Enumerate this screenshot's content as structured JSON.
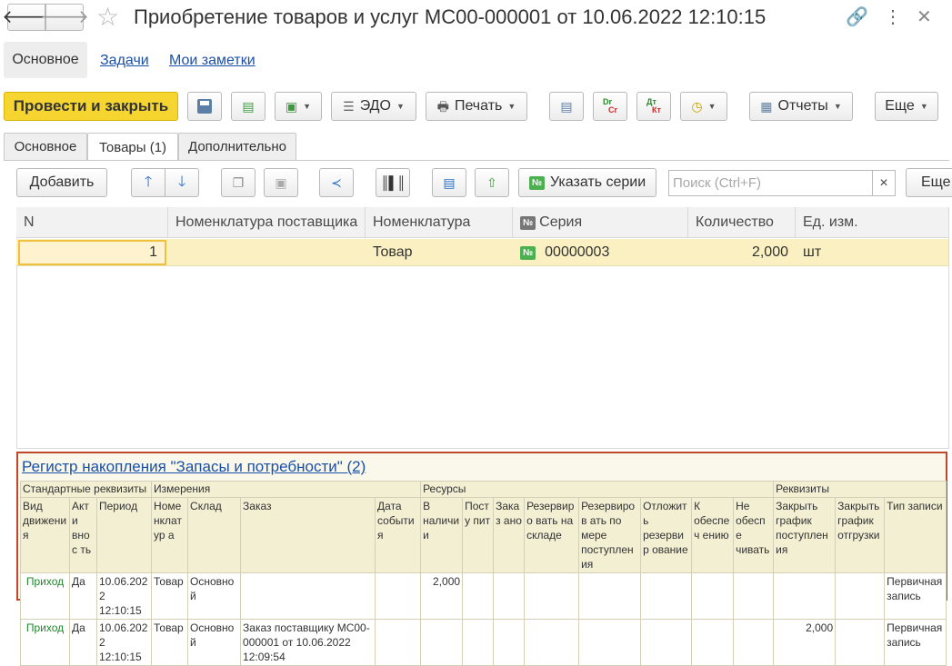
{
  "window": {
    "title": "Приобретение товаров и услуг МС00-000001 от 10.06.2022 12:10:15"
  },
  "nav_links": {
    "main": "Основное",
    "tasks": "Задачи",
    "notes": "Мои заметки"
  },
  "toolbar": {
    "post_close": "Провести и закрыть",
    "edo": "ЭДО",
    "print": "Печать",
    "dr_cr_top": "Dr",
    "dr_cr_bottom": "Cr",
    "dt_kt_top": "Дт",
    "dt_kt_bottom": "Кт",
    "reports": "Отчеты",
    "more": "Еще"
  },
  "tabs": [
    {
      "label": "Основное"
    },
    {
      "label": "Товары (1)"
    },
    {
      "label": "Дополнительно"
    }
  ],
  "grid_toolbar": {
    "add": "Добавить",
    "series_badge": "№",
    "set_series": "Указать серии",
    "search_placeholder": "Поиск (Ctrl+F)",
    "clear": "×",
    "more": "Еще"
  },
  "grid": {
    "columns": [
      "N",
      "Номенклатура поставщика",
      "Номенклатура",
      "Серия",
      "Количество",
      "Ед. изм."
    ],
    "series_col_badge": "№",
    "rows": [
      {
        "n": "1",
        "supplier_item": "",
        "item": "Товар",
        "series_badge": "№",
        "series": "00000003",
        "qty": "2,000",
        "unit": "шт"
      }
    ]
  },
  "register": {
    "title": "Регистр накопления \"Запасы и потребности\" (2)",
    "groups": [
      "Стандартные реквизиты",
      "Измерения",
      "Ресурсы",
      "Реквизиты"
    ],
    "columns": [
      "Вид движения",
      "Акти внос ть",
      "Период",
      "Номе нклатур а",
      "Склад",
      "Заказ",
      "Дата события",
      "В наличии",
      "Посту пит",
      "Заказ ано",
      "Резервиро вать на складе",
      "Резервиров ать по мере поступления",
      "Отложить резервир ование",
      "К обеспеч ению",
      "Не обеспе чивать",
      "Закрыть график поступления",
      "Закрыть график отгрузки",
      "Тип записи"
    ],
    "rows": [
      {
        "kind": "Приход",
        "active": "Да",
        "period": "10.06.2022 12:10:15",
        "item": "Товар",
        "warehouse": "Основной",
        "order": "",
        "event_date": "",
        "in_stock": "2,000",
        "incoming": "",
        "ordered": "",
        "reserve_wh": "",
        "reserve_arrival": "",
        "defer_reserve": "",
        "to_provide": "",
        "not_provide": "",
        "close_in": "",
        "close_out": "",
        "record_type": "Первичная запись"
      },
      {
        "kind": "Приход",
        "active": "Да",
        "period": "10.06.2022 12:10:15",
        "item": "Товар",
        "warehouse": "Основной",
        "order": "Заказ поставщику МС00-000001 от 10.06.2022 12:09:54",
        "event_date": "",
        "in_stock": "",
        "incoming": "",
        "ordered": "",
        "reserve_wh": "",
        "reserve_arrival": "",
        "defer_reserve": "",
        "to_provide": "",
        "not_provide": "",
        "close_in": "2,000",
        "close_out": "",
        "record_type": "Первичная запись"
      }
    ]
  },
  "colors": {
    "accent_yellow": "#f6d530",
    "selected_row": "#fbf0c2",
    "link_blue": "#1a4fa8",
    "register_border": "#c0462c",
    "movement_green": "#1f8a2a"
  }
}
